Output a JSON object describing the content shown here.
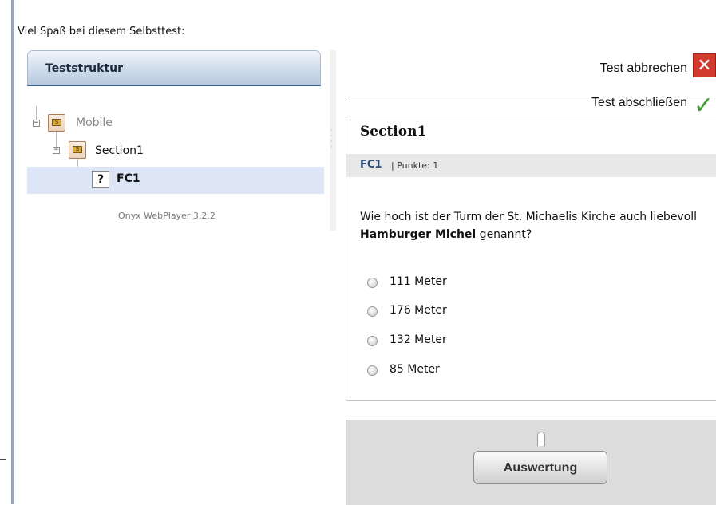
{
  "intro": "Viel Spaß bei diesem Selbsttest:",
  "structure": {
    "title": "Teststruktur",
    "tree": {
      "root": {
        "label": "Mobile",
        "icon": "folder-icon"
      },
      "section": {
        "label": "Section1",
        "icon": "folder-icon"
      },
      "item": {
        "label": "FC1",
        "icon": "question-icon",
        "icon_glyph": "?"
      }
    },
    "player": "Onyx WebPlayer 3.2.2"
  },
  "actions": {
    "abort_label": "Test abbrechen",
    "abort_icon": "close-icon",
    "finish_label": "Test abschließen",
    "finish_icon": "checkmark-icon"
  },
  "question": {
    "section_title": "Section1",
    "item_label": "FC1",
    "points": "| Punkte: 1",
    "text_before": "Wie hoch ist der Turm der St. Michaelis Kirche auch liebevoll ",
    "text_bold": "Hamburger Michel",
    "text_after": " genannt?",
    "answers": [
      "111 Meter",
      "176 Meter",
      "132 Meter",
      "85 Meter"
    ]
  },
  "evaluate_label": "Auswertung",
  "colors": {
    "abort": "#d23a2e",
    "finish": "#3c9b2d",
    "selected_row": "#dde6f5"
  }
}
